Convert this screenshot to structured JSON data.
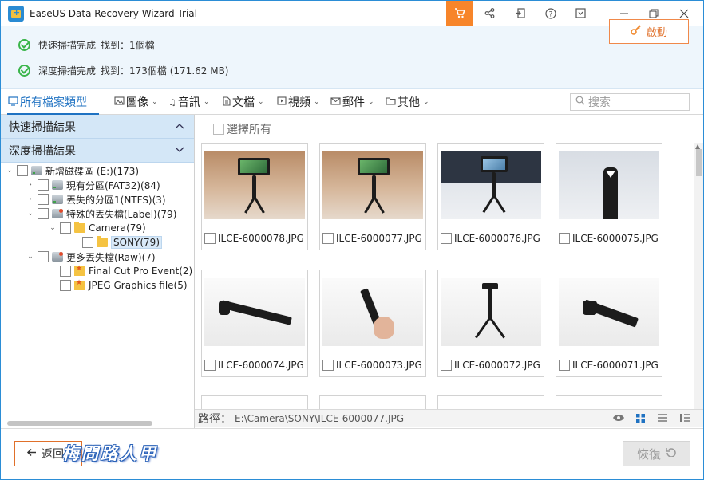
{
  "window": {
    "title": "EaseUS Data Recovery Wizard Trial"
  },
  "toolbar": {
    "icons": [
      "cart-icon",
      "share-icon",
      "export-icon",
      "help-icon",
      "menu-icon"
    ],
    "window_controls": [
      "minimize-icon",
      "restore-icon",
      "close-icon"
    ]
  },
  "status": {
    "quick_label": "快速掃描完成",
    "quick_found": "找到：1個檔",
    "deep_label": "深度掃描完成",
    "deep_found": "找到：173個檔 (171.62 MB)",
    "start_label": "啟動"
  },
  "filters": [
    {
      "label": "所有檔案類型",
      "icon": "monitor-icon"
    },
    {
      "label": "圖像",
      "icon": "image-icon"
    },
    {
      "label": "音訊",
      "icon": "music-icon"
    },
    {
      "label": "文檔",
      "icon": "document-icon"
    },
    {
      "label": "視頻",
      "icon": "video-icon"
    },
    {
      "label": "郵件",
      "icon": "mail-icon"
    },
    {
      "label": "其他",
      "icon": "folder-icon"
    }
  ],
  "search": {
    "placeholder": "搜索"
  },
  "sidebar": {
    "quick_results": "快速掃描結果",
    "deep_results": "深度掃描結果",
    "tree": [
      {
        "label": "新增磁碟區 (E:)(173)"
      },
      {
        "label": "現有分區(FAT32)(84)"
      },
      {
        "label": "丟失的分區1(NTFS)(3)"
      },
      {
        "label": "特殊的丟失檔(Label)(79)"
      },
      {
        "label": "Camera(79)"
      },
      {
        "label": "SONY(79)"
      },
      {
        "label": "更多丟失檔(Raw)(7)"
      },
      {
        "label": "Final Cut Pro Event(2)"
      },
      {
        "label": "JPEG Graphics file(5)"
      }
    ]
  },
  "content": {
    "select_all": "選擇所有",
    "files": [
      {
        "name": "ILCE-6000078.JPG"
      },
      {
        "name": "ILCE-6000077.JPG"
      },
      {
        "name": "ILCE-6000076.JPG"
      },
      {
        "name": "ILCE-6000075.JPG"
      },
      {
        "name": "ILCE-6000074.JPG"
      },
      {
        "name": "ILCE-6000073.JPG"
      },
      {
        "name": "ILCE-6000072.JPG"
      },
      {
        "name": "ILCE-6000071.JPG"
      }
    ]
  },
  "pathbar": {
    "label": "路徑：",
    "value": "E:\\Camera\\SONY\\ILCE-6000077.JPG"
  },
  "view_icons": [
    "eye-icon",
    "grid-view-icon",
    "list-view-icon",
    "detail-view-icon"
  ],
  "footer": {
    "back_label": "返回",
    "recover_label": "恢復",
    "watermark": "梅問路人甲"
  }
}
